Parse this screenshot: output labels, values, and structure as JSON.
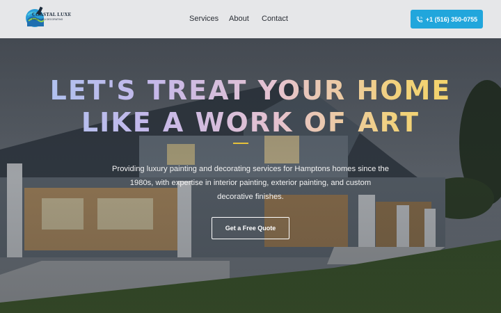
{
  "brand": {
    "name_line1": "COASTAL LUXE",
    "name_line2": "PAINTING & DECORATING",
    "logo_icon": "paint-brush-wave-icon"
  },
  "nav": {
    "items": [
      {
        "label": "Services"
      },
      {
        "label": "About"
      },
      {
        "label": "Contact"
      }
    ]
  },
  "header": {
    "phone_label": "+1 (516) 350-0755",
    "phone_icon": "phone-icon",
    "phone_color": "#21a6dc"
  },
  "hero": {
    "headline_line1": "LET'S TREAT YOUR HOME",
    "headline_line2": "LIKE A WORK OF ART",
    "subtext": "Providing luxury painting and decorating services for Hamptons homes since the 1980s, with expertise in interior painting, exterior painting, and custom decorative finishes.",
    "cta_label": "Get a Free Quote",
    "accent_color": "#e6c13a"
  }
}
